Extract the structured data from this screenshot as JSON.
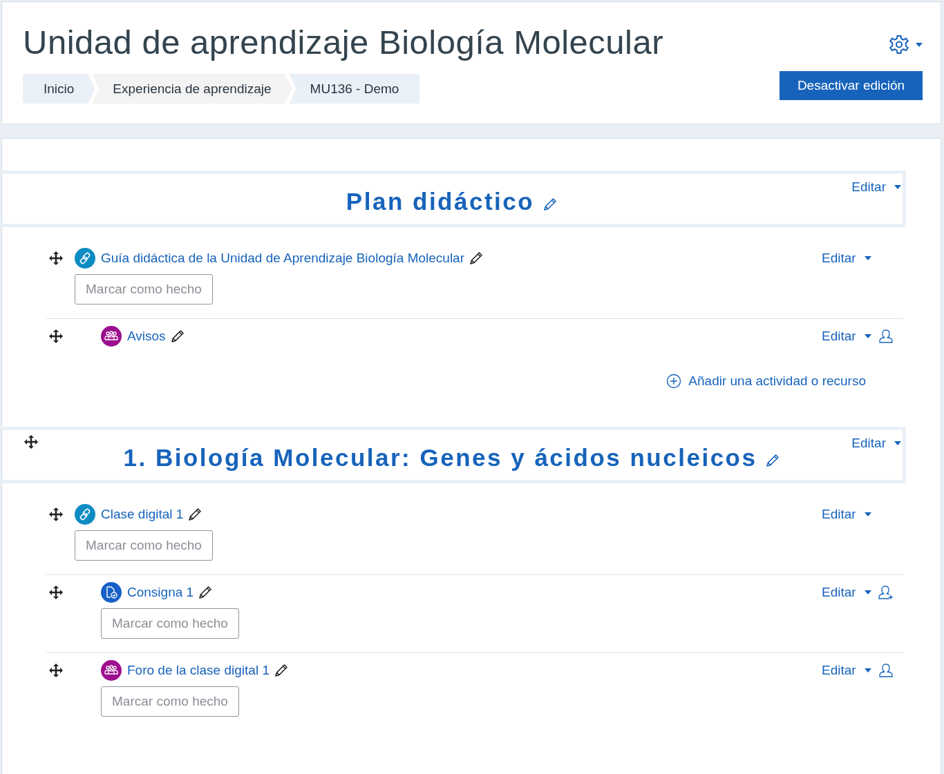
{
  "header": {
    "title": "Unidad de aprendizaje Biología Molecular",
    "breadcrumb": [
      {
        "label": "Inicio"
      },
      {
        "label": "Experiencia de aprendizaje"
      },
      {
        "label": "MU136 - Demo"
      }
    ],
    "edit_button": "Desactivar edición"
  },
  "sections": [
    {
      "title": "Plan didáctico",
      "draggable": false,
      "edit_menu": "Editar",
      "add_link": "Añadir una actividad o recurso",
      "activities": [
        {
          "kind": "url",
          "name": "Guía didáctica de la Unidad de Aprendizaje Biología Molecular",
          "indented": false,
          "completion": "Marcar como hecho",
          "edit_menu": "Editar"
        },
        {
          "kind": "forum",
          "name": "Avisos",
          "indented": true,
          "edit_menu": "Editar",
          "access": {
            "kind": "person"
          }
        }
      ]
    },
    {
      "title": "1. Biología Molecular: Genes y ácidos nucleicos",
      "draggable": true,
      "edit_menu": "Editar",
      "activities": [
        {
          "kind": "url",
          "name": "Clase digital 1",
          "indented": false,
          "completion": "Marcar como hecho",
          "edit_menu": "Editar"
        },
        {
          "kind": "assign",
          "name": "Consigna 1",
          "indented": true,
          "completion": "Marcar como hecho",
          "edit_menu": "Editar",
          "access": {
            "kind": "person_plus"
          }
        },
        {
          "kind": "forum",
          "name": "Foro de la clase digital 1",
          "indented": true,
          "completion": "Marcar como hecho",
          "edit_menu": "Editar",
          "access": {
            "kind": "person"
          }
        }
      ]
    }
  ]
}
